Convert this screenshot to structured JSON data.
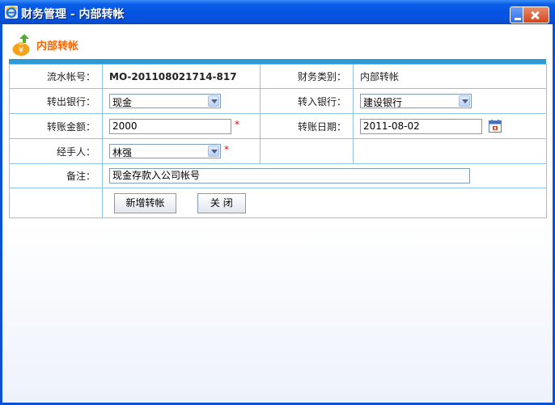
{
  "window": {
    "title": "财务管理 - 内部转帐"
  },
  "page": {
    "heading": "内部转帐"
  },
  "form": {
    "serial_label": "流水帐号：",
    "serial_value": "MO-201108021714-817",
    "category_label": "财务类别：",
    "category_value": "内部转帐",
    "out_bank_label": "转出银行：",
    "out_bank_value": "现金",
    "in_bank_label": "转入银行：",
    "in_bank_value": "建设银行",
    "amount_label": "转账金额：",
    "amount_value": "2000",
    "date_label": "转账日期：",
    "date_value": "2011-08-02",
    "handler_label": "经手人：",
    "handler_value": "林强",
    "remark_label": "备注：",
    "remark_value": "现金存款入公司帐号",
    "required_mark": "*"
  },
  "buttons": {
    "add_label": "新增转帐",
    "close_label": "关  闭"
  },
  "colors": {
    "title_bar": "#0554e3",
    "accent": "#2b9bd8",
    "heading": "#ff6600",
    "required": "#ee0000"
  }
}
